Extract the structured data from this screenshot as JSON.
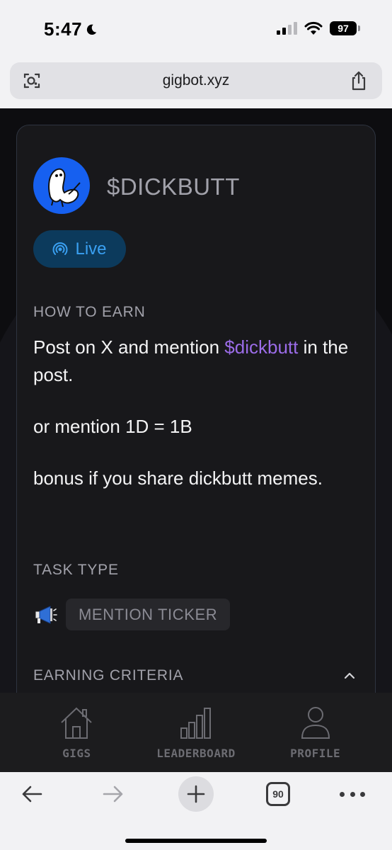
{
  "status_bar": {
    "time": "5:47",
    "battery": "97"
  },
  "browser": {
    "url": "gigbot.xyz",
    "tab_count": "90"
  },
  "card": {
    "token_name": "$DICKBUTT",
    "status_label": "Live",
    "how_to_earn_heading": "HOW TO EARN",
    "instruction_prefix": "Post on X and mention ",
    "instruction_ticker": "$dickbutt",
    "instruction_suffix": " in the post.",
    "instruction_alt": "or mention 1D = 1B",
    "instruction_bonus": "bonus if you share dickbutt memes.",
    "task_type_heading": "TASK TYPE",
    "task_type_value": "MENTION TICKER",
    "earning_criteria_heading": "EARNING CRITERIA"
  },
  "nav": {
    "items": [
      {
        "label": "GIGS",
        "icon": "home-icon"
      },
      {
        "label": "LEADERBOARD",
        "icon": "bar-chart-icon"
      },
      {
        "label": "PROFILE",
        "icon": "user-icon"
      }
    ]
  },
  "colors": {
    "page_bg": "#0d0d10",
    "card_bg": "#18181b",
    "accent_purple": "#9b6ce8",
    "live_blue": "#3aa0f2",
    "avatar_blue": "#1660f0"
  }
}
